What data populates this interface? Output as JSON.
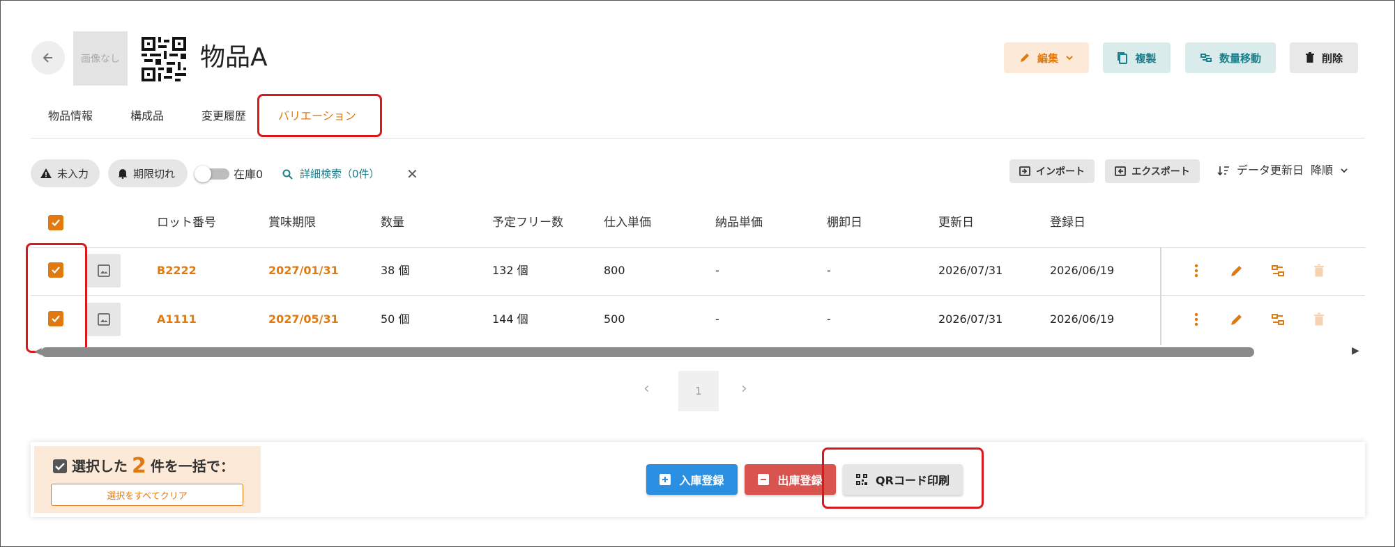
{
  "header": {
    "no_image_label": "画像なし",
    "title": "物品A",
    "buttons": {
      "edit": "編集",
      "duplicate": "複製",
      "move_quantity": "数量移動",
      "delete": "削除"
    }
  },
  "tabs": [
    {
      "label": "物品情報",
      "active": false
    },
    {
      "label": "構成品",
      "active": false
    },
    {
      "label": "変更履歴",
      "active": false
    },
    {
      "label": "バリエーション",
      "active": true
    }
  ],
  "filters": {
    "not_entered": "未入力",
    "expired": "期限切れ",
    "stock_zero_label": "在庫0",
    "stock_zero_enabled": false,
    "advanced_search": "詳細検索（0件）"
  },
  "toolbar": {
    "import": "インポート",
    "export": "エクスポート",
    "sort_field": "データ更新日",
    "sort_order": "降順"
  },
  "table": {
    "columns": [
      "ロット番号",
      "賞味期限",
      "数量",
      "予定フリー数",
      "仕入単価",
      "納品単価",
      "棚卸日",
      "更新日",
      "登録日"
    ],
    "rows": [
      {
        "checked": true,
        "lot": "B2222",
        "expiry": "2027/01/31",
        "quantity": "38 個",
        "planned_free": "132 個",
        "purchase_price": "800",
        "delivery_price": "-",
        "inventory_date": "-",
        "updated": "2026/07/31",
        "registered": "2026/06/19"
      },
      {
        "checked": true,
        "lot": "A1111",
        "expiry": "2027/05/31",
        "quantity": "50 個",
        "planned_free": "144 個",
        "purchase_price": "500",
        "delivery_price": "-",
        "inventory_date": "-",
        "updated": "2026/07/31",
        "registered": "2026/06/19"
      }
    ]
  },
  "pagination": {
    "current_page": "1"
  },
  "bulk": {
    "prefix": "選択した",
    "count": "2",
    "suffix": "件を一括で：",
    "clear_label": "選択をすべてクリア",
    "stock_in": "入庫登録",
    "stock_out": "出庫登録",
    "qr_print": "QRコード印刷"
  },
  "colors": {
    "accent": "#e07a10",
    "teal": "#1a7f8c",
    "highlight": "#d7191c",
    "stock_in": "#2a8fe0",
    "stock_out": "#d9534f"
  }
}
